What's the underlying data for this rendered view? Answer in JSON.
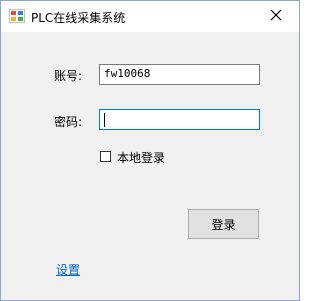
{
  "window": {
    "title": "PLC在线采集系统",
    "icon": "app-icon",
    "close_icon": "close-icon"
  },
  "form": {
    "account_label": "账号:",
    "account_value": "fw10068",
    "password_label": "密码:",
    "password_value": "",
    "local_login_label": "本地登录",
    "local_login_checked": false,
    "login_button": "登录",
    "settings_link": "设置"
  },
  "colors": {
    "focus_border": "#0078d7",
    "link": "#0066cc"
  }
}
